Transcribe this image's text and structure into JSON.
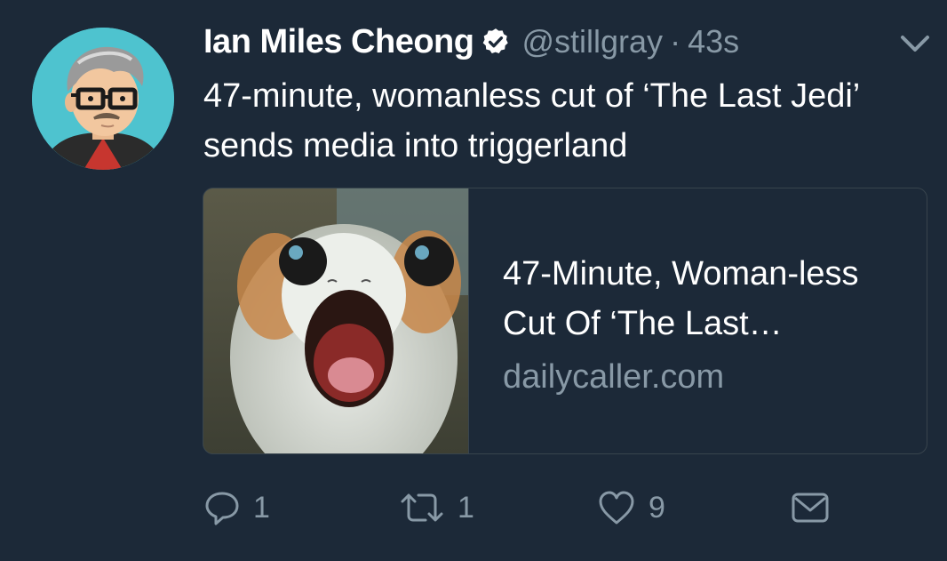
{
  "author": {
    "display_name": "Ian Miles Cheong",
    "handle": "@stillgray",
    "separator": "·",
    "timestamp": "43s",
    "verified": true
  },
  "tweet": {
    "text": "47-minute, womanless cut of ‘The Last Jedi’ sends media into triggerland"
  },
  "card": {
    "title": "47-Minute, Woman-less Cut Of ‘The Last…",
    "domain": "dailycaller.com",
    "image_description_icon": "porg-photo"
  },
  "actions": {
    "reply_count": "1",
    "retweet_count": "1",
    "like_count": "9"
  },
  "colors": {
    "background": "#1c2938",
    "secondary_text": "#8899a6",
    "border": "#38444d",
    "primary_text": "#ffffff"
  }
}
